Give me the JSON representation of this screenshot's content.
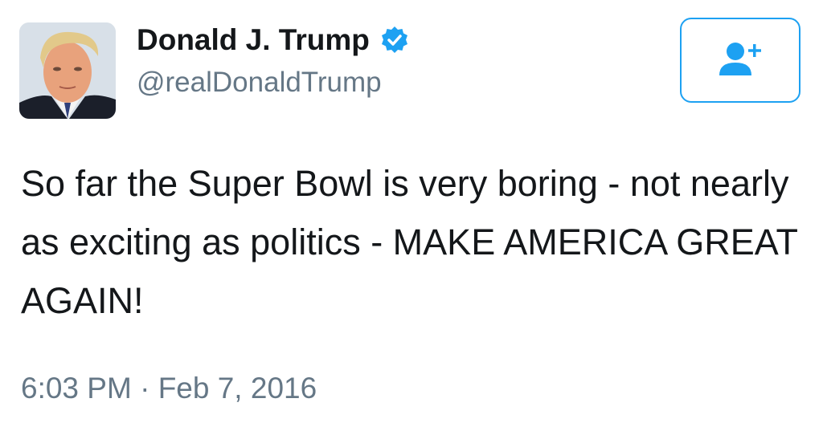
{
  "user": {
    "display_name": "Donald J. Trump",
    "handle": "@realDonaldTrump",
    "verified": true
  },
  "tweet": {
    "text": "So far the Super Bowl is very boring - not nearly as exciting as politics - MAKE AMERICA GREAT AGAIN!",
    "time": "6:03 PM",
    "separator": "·",
    "date": "Feb 7, 2016"
  },
  "icons": {
    "follow": "add-user-icon",
    "verified": "verified-badge-icon"
  },
  "colors": {
    "accent": "#1da1f2",
    "text": "#14171a",
    "secondary_text": "#657786"
  }
}
